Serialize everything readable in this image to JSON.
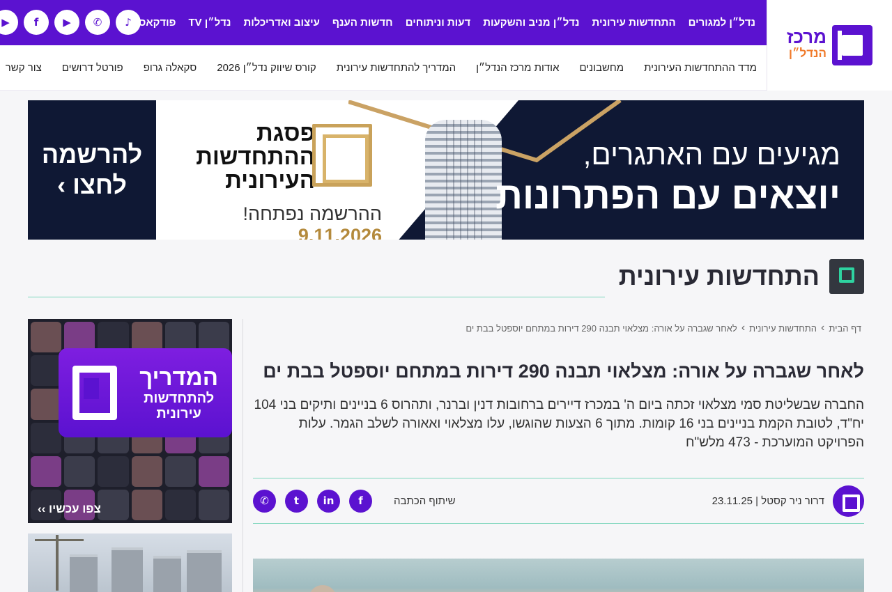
{
  "brand": {
    "logo_line1": "מרכז",
    "logo_line2": "הנדל״ן"
  },
  "topnav": [
    {
      "label": "נדל״ן למגורים"
    },
    {
      "label": "התחדשות עירונית"
    },
    {
      "label": "נדל״ן מניב והשקעות"
    },
    {
      "label": "דעות וניתוחים"
    },
    {
      "label": "חדשות הענף"
    },
    {
      "label": "עיצוב ואדריכלות"
    },
    {
      "label": "נדל״ן TV"
    },
    {
      "label": "פודקאסטים"
    }
  ],
  "socials": [
    {
      "name": "youtube",
      "glyph": "▶"
    },
    {
      "name": "facebook",
      "glyph": "f"
    },
    {
      "name": "youtube-red",
      "glyph": "▶"
    },
    {
      "name": "whatsapp",
      "glyph": "✆"
    },
    {
      "name": "tiktok",
      "glyph": "♪"
    }
  ],
  "subnav": [
    {
      "label": "מדד ההתחדשות העירונית"
    },
    {
      "label": "מחשבונים"
    },
    {
      "label": "אודות מרכז הנדל״ן"
    },
    {
      "label": "המדריך להתחדשות עירונית"
    },
    {
      "label": "קורס שיווק נדל״ן 2026"
    },
    {
      "label": "סקאלה גרופ"
    },
    {
      "label": "פורטל דרושים"
    },
    {
      "label": "צור קשר"
    }
  ],
  "banner": {
    "pitch_line1": "מגיעים עם האתגרים,",
    "pitch_line2": "יוצאים עם הפתרונות",
    "event_title": "פסגת ההתחדשות העירונית",
    "event_date": "9.11.2026",
    "event_note": "ההרשמה נפתחה!",
    "cta_line1": "להרשמה",
    "cta_line2": "לחצו ›"
  },
  "section": {
    "title": "התחדשות עירונית"
  },
  "breadcrumb": {
    "home": "דף הבית",
    "category": "התחדשות עירונית",
    "current": "לאחר שגברה על אורה: מצלאוי תבנה 290 דירות במתחם יוספטל בבת ים"
  },
  "article": {
    "title": "לאחר שגברה על אורה: מצלאוי תבנה 290 דירות במתחם יוספטל בבת ים",
    "lede": "החברה שבשליטת סמי מצלאוי זכתה ביום ה' במכרז דיירים ברחובות דנין וברנר, ותהרוס 6 בניינים ותיקים בני 104 יח\"ד, לטובת הקמת בניינים בני 16 קומות. מתוך 6 הצעות שהוגשו, עלו מצלאוי ואאורה לשלב הגמר. עלות הפרויקט המוערכת - 473 מלש\"ח",
    "author_line": "דרור ניר קסטל | 23.11.25",
    "share_label": "שיתוף הכתבה"
  },
  "share_buttons": [
    {
      "name": "facebook",
      "glyph": "f"
    },
    {
      "name": "linkedin",
      "glyph": "in"
    },
    {
      "name": "twitter",
      "glyph": "t"
    },
    {
      "name": "whatsapp",
      "glyph": "✆"
    }
  ],
  "side_ad": {
    "big": "המדריך",
    "line2": "להתחדשות",
    "line3": "עירונית",
    "watch": "צפו עכשיו ››"
  },
  "colors": {
    "brand_purple": "#5b12d0",
    "accent_green": "#2ed3a0",
    "rule_green": "#7bd5bb"
  }
}
